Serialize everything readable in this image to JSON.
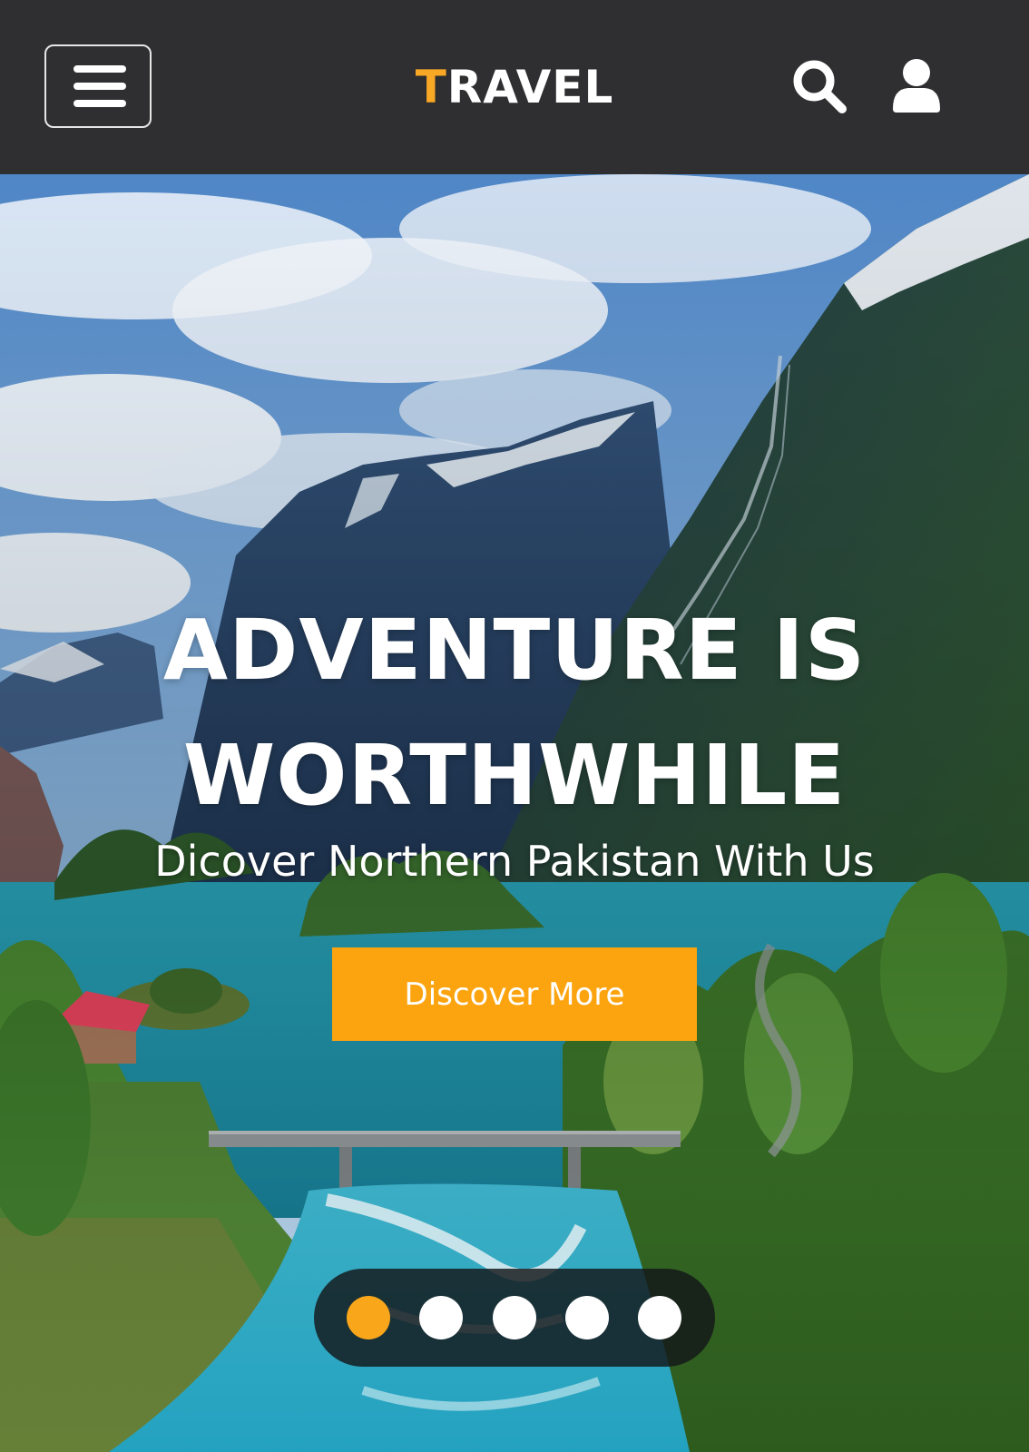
{
  "header": {
    "menu_icon": "hamburger-menu-icon",
    "brand_initial": "T",
    "brand_rest": "RAVEL",
    "search_icon": "search-icon",
    "user_icon": "user-icon"
  },
  "hero": {
    "title_line1": "ADVENTURE IS",
    "title_line2": "WORTHWHILE",
    "subtitle": "Dicover Northern Pakistan With Us",
    "cta_label": "Discover More"
  },
  "carousel": {
    "slide_count": 5,
    "active_index": 0
  },
  "colors": {
    "header_bg": "#2f2e30",
    "accent": "#f9a825",
    "button_bg": "#fba40f",
    "text": "#ffffff"
  }
}
